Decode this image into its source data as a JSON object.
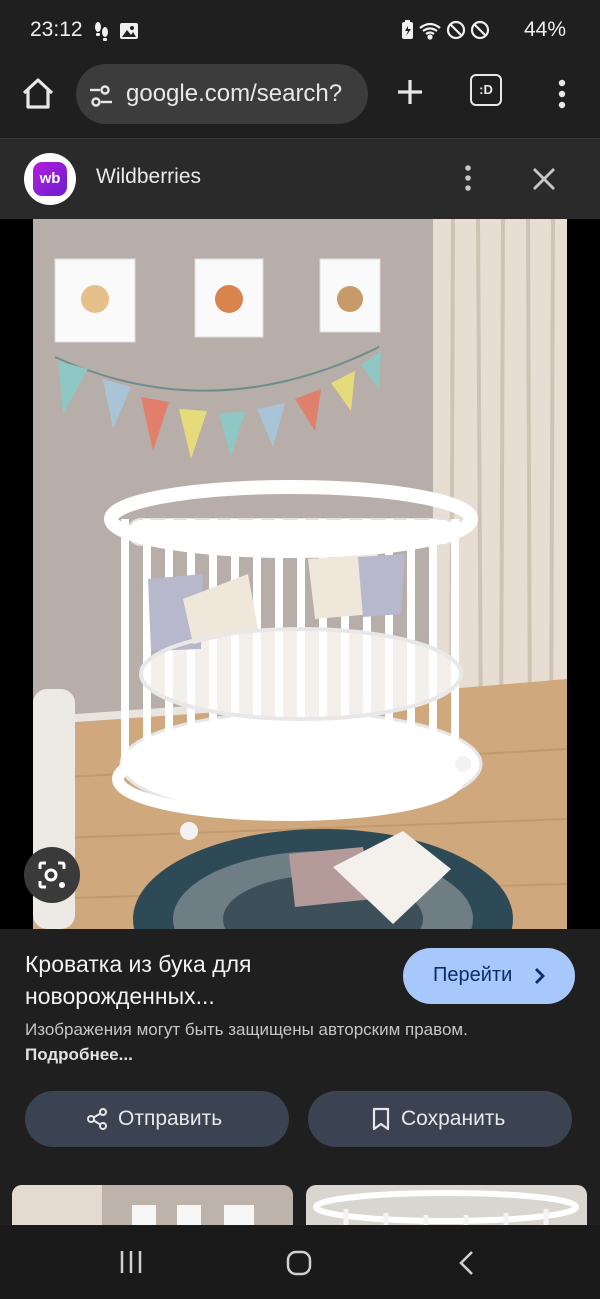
{
  "status": {
    "time": "23:12",
    "battery": "44%",
    "icons": [
      "step-counter-icon",
      "gallery-icon",
      "battery-saver-icon",
      "wifi-icon",
      "do-not-disturb-icon",
      "blocked-icon"
    ]
  },
  "browser": {
    "url": "google.com/search?",
    "tabs_count": ":D",
    "icons": [
      "home-icon",
      "tune-icon",
      "plus-icon",
      "tabs-icon",
      "more-vert-icon"
    ]
  },
  "site": {
    "logo_text": "wb",
    "name": "Wildberries"
  },
  "result": {
    "title": "Кроватка из бука для новорожденных...",
    "go_label": "Перейти",
    "copyright_text": "Изображения могут быть защищены авторским правом.",
    "more_link": "Подробнее..."
  },
  "actions": {
    "share_label": "Отправить",
    "save_label": "Сохранить"
  },
  "colors": {
    "background": "#1f1f1f",
    "go_button": "#a8c7fa",
    "action_button": "#3b4252",
    "wb_logo": "#9b1ed8"
  }
}
